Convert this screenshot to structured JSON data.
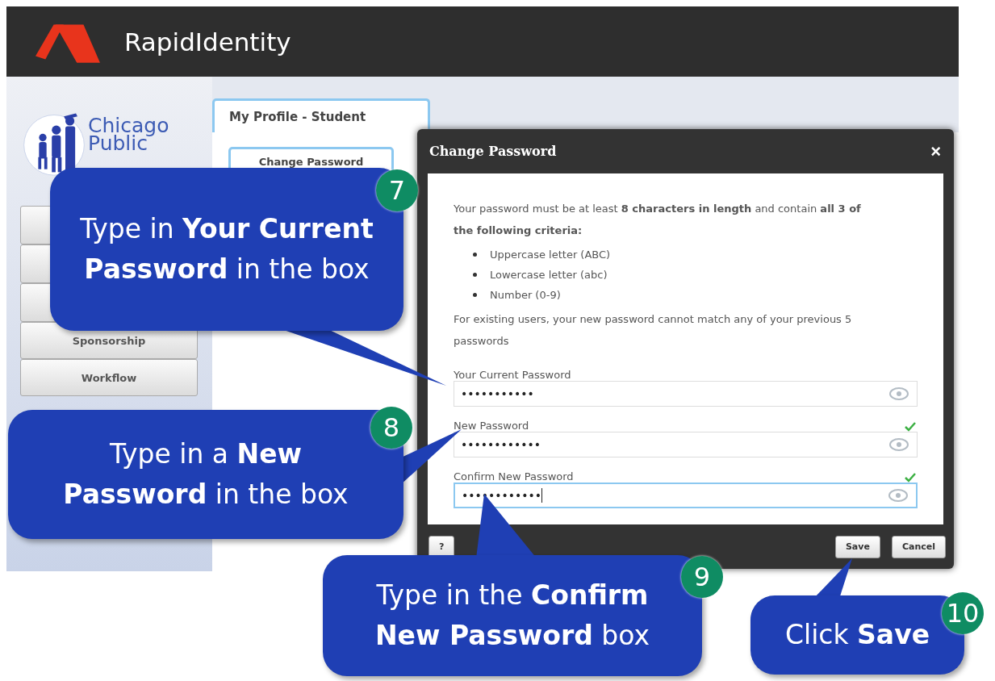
{
  "header": {
    "brand": "RapidIdentity"
  },
  "sidebar": {
    "logo_lines": [
      "Chicago",
      "Public"
    ],
    "nav_items": [
      "Sponsorship",
      "Workflow"
    ]
  },
  "tab": {
    "label": "My Profile - Student",
    "selected": true
  },
  "panel_button": "Change Password",
  "dialog": {
    "title": "Change Password",
    "close": "×",
    "intro": "Your password must be at least **8 characters in length** and contain **all 3 of the following criteria:**",
    "criteria": [
      "Uppercase letter (ABC)",
      "Lowercase letter (abc)",
      "Number (0-9)"
    ],
    "note": "For existing users, your new password cannot match any of your previous 5 passwords",
    "fields": [
      {
        "label": "Your Current Password",
        "value": "•••••••••••",
        "valid": false,
        "focused": false
      },
      {
        "label": "New Password",
        "value": "••••••••••••",
        "valid": true,
        "focused": false
      },
      {
        "label": "Confirm New Password",
        "value": "••••••••••••",
        "valid": true,
        "focused": true
      }
    ],
    "help": "?",
    "buttons": [
      "Save",
      "Cancel"
    ]
  },
  "callouts": [
    {
      "number": "7",
      "text": "Type in **Your Current Password** in the box"
    },
    {
      "number": "8",
      "text": "Type in a **New Password** in the box"
    },
    {
      "number": "9",
      "text": "Type in the **Confirm New Password** box"
    },
    {
      "number": "10",
      "text": "Click **Save**"
    }
  ]
}
